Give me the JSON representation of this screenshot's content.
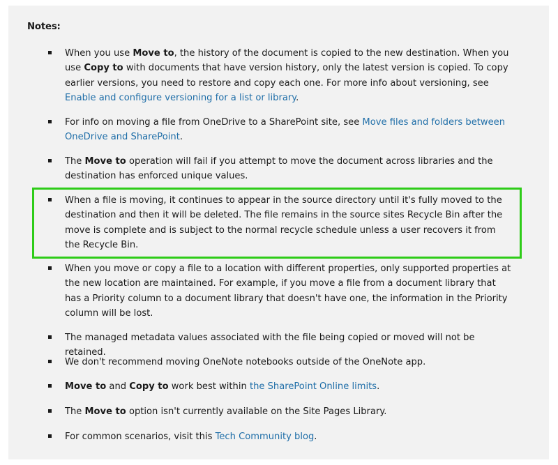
{
  "notes_title": "Notes:",
  "items": [
    {
      "p1": "When you use ",
      "b1": "Move to",
      "p2": ", the history of the document is copied to the new destination. When you use ",
      "b2": "Copy to",
      "p3": " with documents that have version history, only the latest version is copied. To copy earlier versions, you need to restore and copy each one. For more info about versioning, see ",
      "link": "Enable and configure versioning for a list or library",
      "p4": "."
    },
    {
      "p1": "For info on moving a file from OneDrive to a SharePoint site, see ",
      "link": "Move files and folders between OneDrive and SharePoint",
      "p2": "."
    },
    {
      "p1": "The ",
      "b1": "Move to",
      "p2": " operation will fail if you attempt to move the document across libraries and the destination has enforced unique values."
    },
    {
      "text": "When a file is moving, it continues to appear in the source directory until it's fully moved to the destination and then it will be deleted. The file remains in the source sites Recycle Bin after the move is complete and is subject to the normal recycle schedule unless a user recovers it from the Recycle Bin."
    },
    {
      "text": "When you move or copy a file to a location with different properties, only supported properties at the new location are maintained. For example, if you move a file from a document library that has a Priority column to a document library that doesn't have one, the information in the Priority column will be lost."
    },
    {
      "text": "The managed metadata values associated with the file being copied or moved will not be retained."
    },
    {
      "text": "We don't recommend moving OneNote notebooks outside of the OneNote app."
    },
    {
      "b1": "Move to",
      "p1": " and ",
      "b2": "Copy to",
      "p2": " work best within ",
      "link": "the SharePoint Online limits",
      "p3": "."
    },
    {
      "p1": "The ",
      "b1": "Move to",
      "p2": " option isn't currently available on the Site Pages Library."
    },
    {
      "p1": "For common scenarios, visit this ",
      "link": "Tech Community blog",
      "p2": "."
    }
  ],
  "colors": {
    "background": "#f2f2f2",
    "text": "#1a1a1a",
    "link": "#1f6ea8",
    "highlight": "#2ecc18"
  }
}
